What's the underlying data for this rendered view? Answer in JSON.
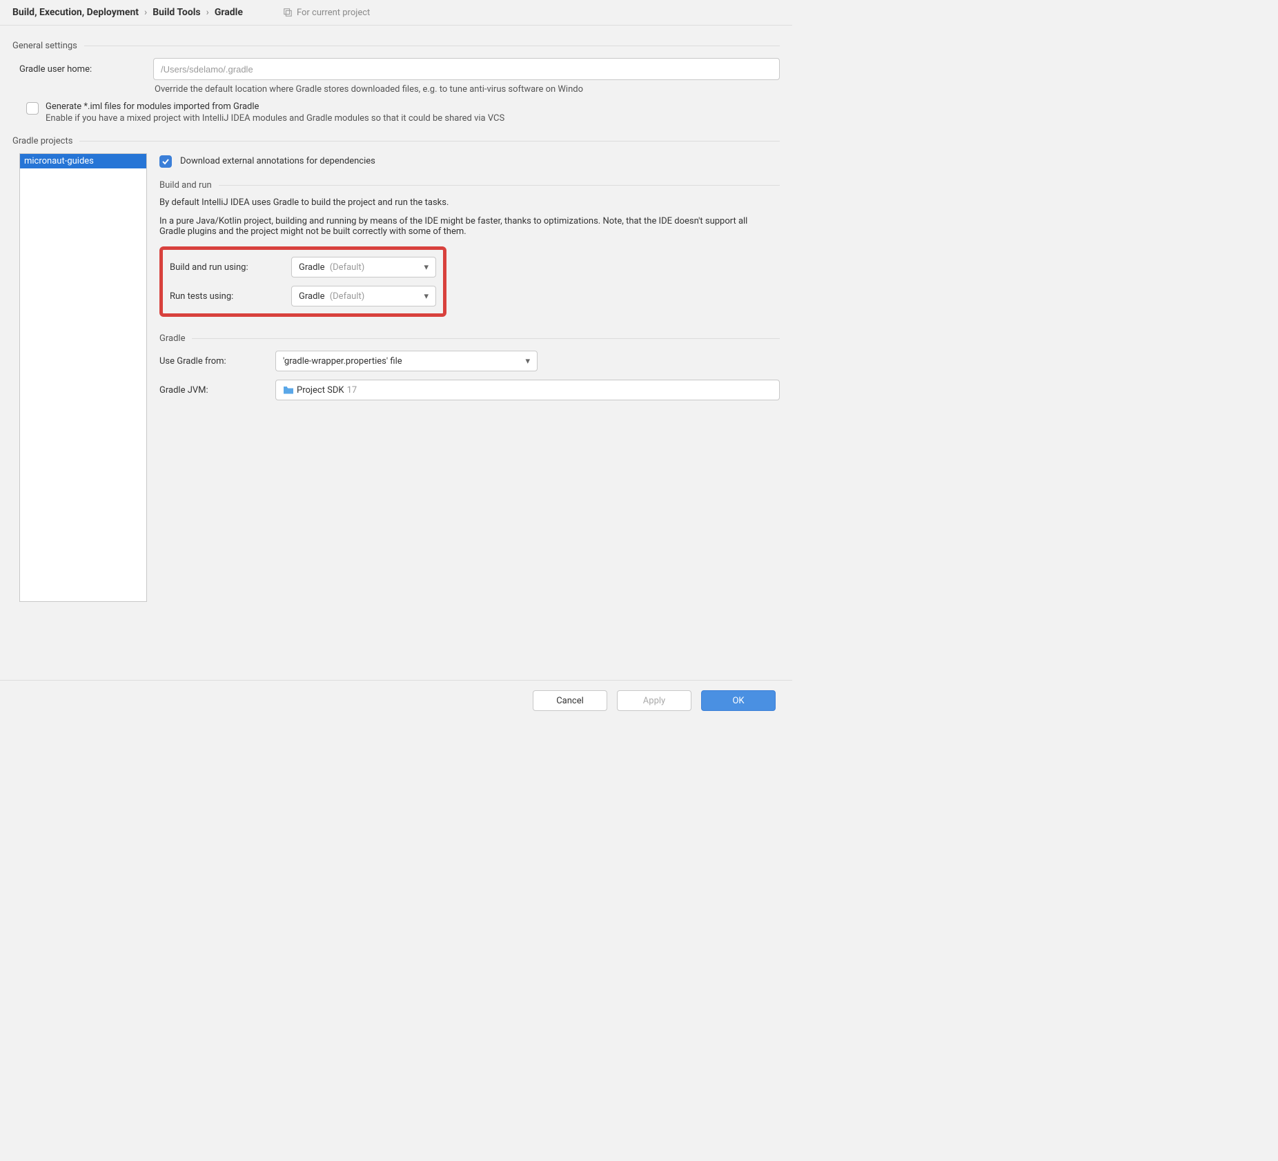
{
  "breadcrumb": {
    "seg1": "Build, Execution, Deployment",
    "seg2": "Build Tools",
    "seg3": "Gradle"
  },
  "scope_label": "For current project",
  "general": {
    "title": "General settings",
    "user_home_label": "Gradle user home:",
    "user_home_placeholder": "/Users/sdelamo/.gradle",
    "user_home_help": "Override the default location where Gradle stores downloaded files, e.g. to tune anti-virus software on Windo",
    "generate_iml_label": "Generate *.iml files for modules imported from Gradle",
    "generate_iml_help": "Enable if you have a mixed project with IntelliJ IDEA modules and Gradle modules so that it could be shared via VCS"
  },
  "projects": {
    "title": "Gradle projects",
    "items": [
      "micronaut-guides"
    ],
    "download_annotations_label": "Download external annotations for dependencies"
  },
  "build_run": {
    "title": "Build and run",
    "desc1": "By default IntelliJ IDEA uses Gradle to build the project and run the tasks.",
    "desc2": "In a pure Java/Kotlin project, building and running by means of the IDE might be faster, thanks to optimizations. Note, that the IDE doesn't support all Gradle plugins and the project might not be built correctly with some of them.",
    "build_using_label": "Build and run using:",
    "build_using_value": "Gradle",
    "build_using_suffix": "(Default)",
    "run_tests_label": "Run tests using:",
    "run_tests_value": "Gradle",
    "run_tests_suffix": "(Default)"
  },
  "gradle": {
    "title": "Gradle",
    "use_from_label": "Use Gradle from:",
    "use_from_value": "'gradle-wrapper.properties' file",
    "jvm_label": "Gradle JVM:",
    "jvm_value": "Project SDK",
    "jvm_suffix": "17"
  },
  "footer": {
    "cancel": "Cancel",
    "apply": "Apply",
    "ok": "OK"
  }
}
